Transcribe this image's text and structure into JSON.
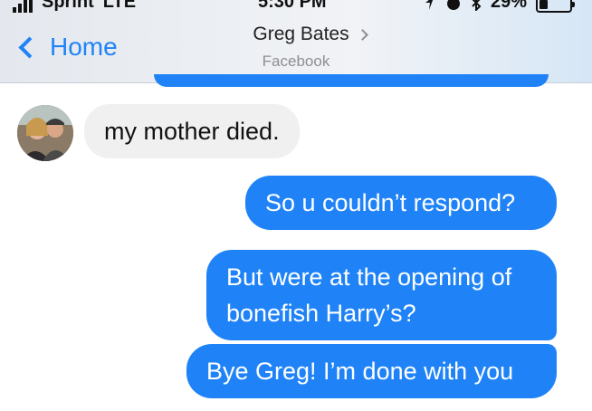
{
  "status_bar": {
    "carrier": "Sprint",
    "network": "LTE",
    "time": "5:30 PM",
    "battery": "29%",
    "battery_level": 0.29
  },
  "header": {
    "back_label": "Home",
    "contact_name": "Greg Bates",
    "contact_subtitle": "Facebook"
  },
  "messages": [
    {
      "direction": "incoming",
      "text": "my mother died."
    },
    {
      "direction": "outgoing",
      "text": "So u couldn’t respond?"
    },
    {
      "direction": "outgoing",
      "lines": [
        "But were at the opening of",
        "bonefish Harry’s?"
      ]
    },
    {
      "direction": "outgoing",
      "text": "Bye Greg! I’m done with you"
    }
  ],
  "colors": {
    "accent": "#1f83f7",
    "incoming_bubble": "#f0f0f0",
    "secondary_text": "#8e8e93"
  }
}
